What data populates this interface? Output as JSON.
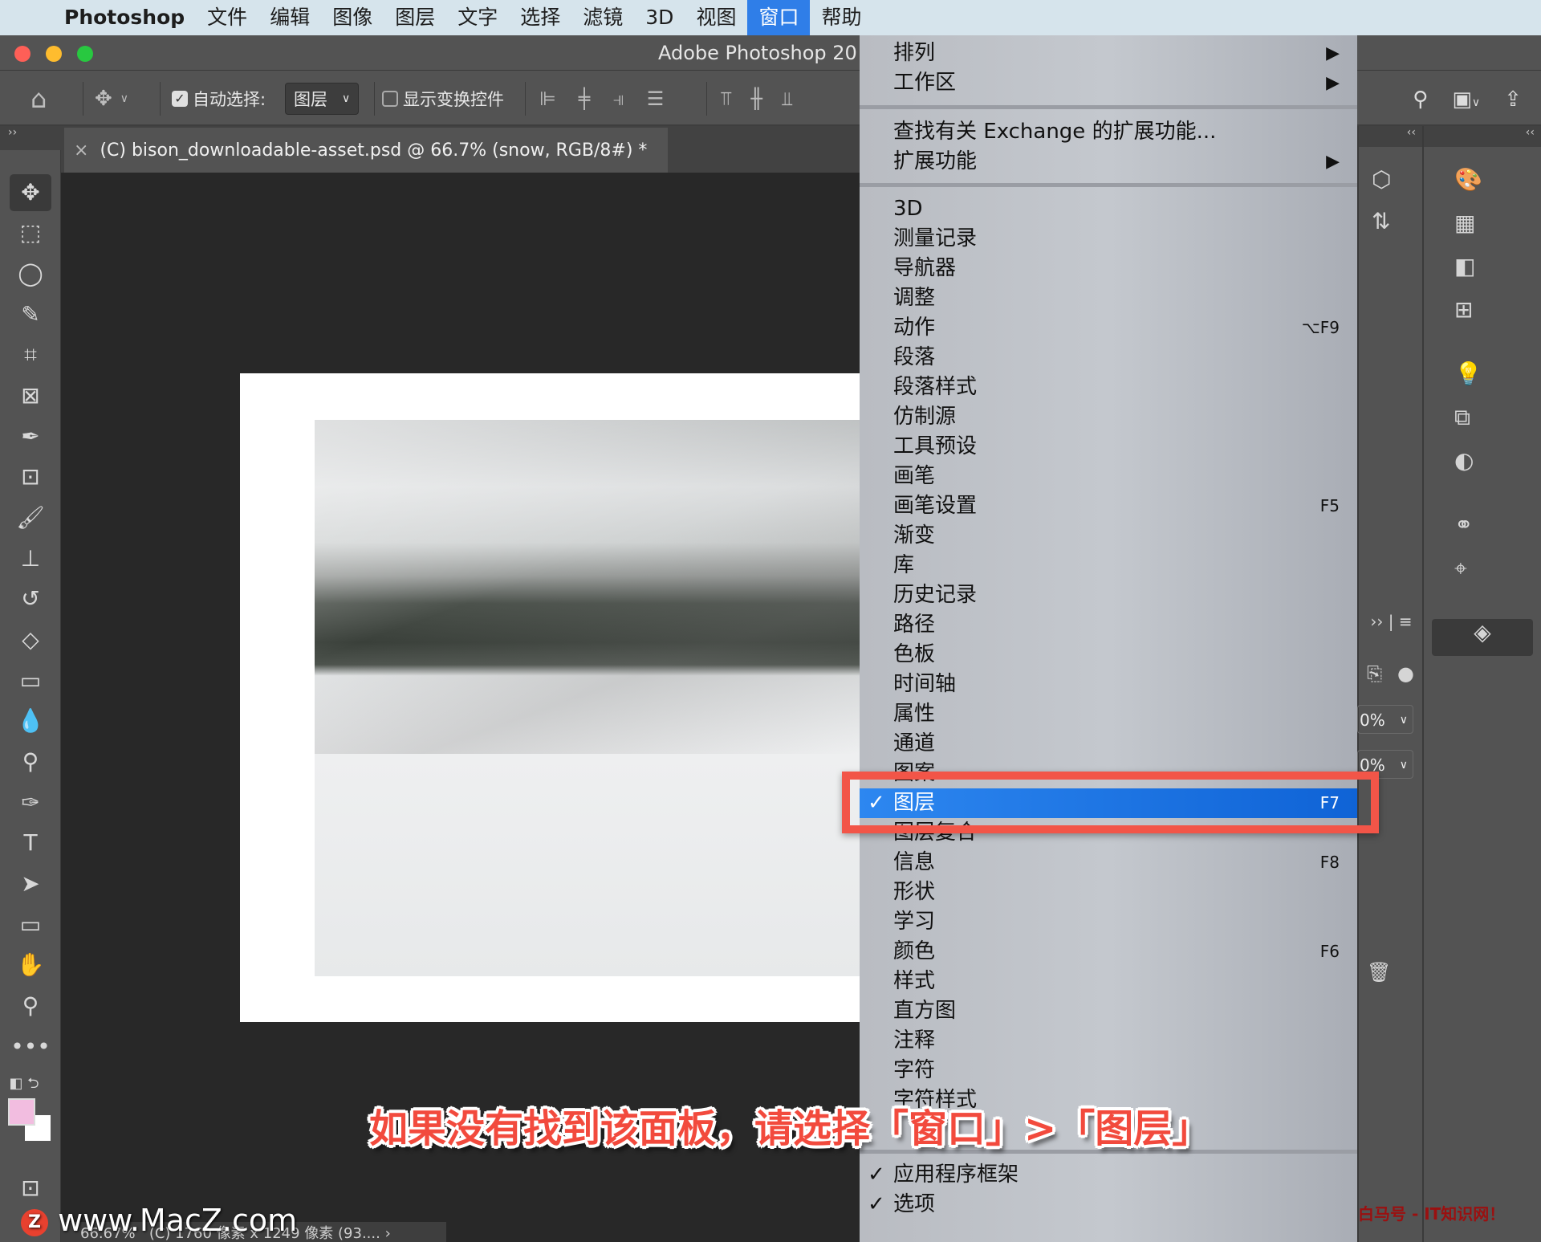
{
  "menubar": {
    "apple": "",
    "app": "Photoshop",
    "items": [
      "文件",
      "编辑",
      "图像",
      "图层",
      "文字",
      "选择",
      "滤镜",
      "3D",
      "视图",
      "窗口",
      "帮助"
    ],
    "active": "窗口"
  },
  "window": {
    "title": "Adobe Photoshop 20"
  },
  "options": {
    "auto_select_label": "自动选择:",
    "auto_select_checked": true,
    "auto_select_target": "图层",
    "show_transform_label": "显示变换控件",
    "show_transform_checked": false
  },
  "document_tab": {
    "close": "×",
    "title": "(C) bison_downloadable-asset.psd @ 66.7% (snow, RGB/8#) *"
  },
  "window_menu": {
    "group1": [
      {
        "label": "排列",
        "submenu": true
      },
      {
        "label": "工作区",
        "submenu": true
      }
    ],
    "group2": [
      {
        "label": "查找有关 Exchange 的扩展功能..."
      },
      {
        "label": "扩展功能",
        "submenu": true
      }
    ],
    "group3": [
      {
        "label": "3D"
      },
      {
        "label": "测量记录"
      },
      {
        "label": "导航器"
      },
      {
        "label": "调整"
      },
      {
        "label": "动作",
        "shortcut": "⌥F9"
      },
      {
        "label": "段落"
      },
      {
        "label": "段落样式"
      },
      {
        "label": "仿制源"
      },
      {
        "label": "工具预设"
      },
      {
        "label": "画笔"
      },
      {
        "label": "画笔设置",
        "shortcut": "F5"
      },
      {
        "label": "渐变"
      },
      {
        "label": "库"
      },
      {
        "label": "历史记录"
      },
      {
        "label": "路径"
      },
      {
        "label": "色板"
      },
      {
        "label": "时间轴"
      },
      {
        "label": "属性"
      },
      {
        "label": "通道"
      },
      {
        "label": "图案"
      },
      {
        "label": "图层",
        "shortcut": "F7",
        "checked": true,
        "highlighted": true
      },
      {
        "label": "图层复合"
      },
      {
        "label": "信息",
        "shortcut": "F8"
      },
      {
        "label": "形状"
      },
      {
        "label": "学习"
      },
      {
        "label": "颜色",
        "shortcut": "F6"
      },
      {
        "label": "样式"
      },
      {
        "label": "直方图"
      },
      {
        "label": "注释"
      },
      {
        "label": "字符"
      },
      {
        "label": "字符样式"
      }
    ],
    "group4": [
      {
        "label": "应用程序框架",
        "checked": true
      },
      {
        "label": "选项",
        "checked": true
      }
    ]
  },
  "caption": "如果没有找到该面板，请选择「窗口」>「图层」",
  "layers_panel": {
    "opacity": "0%",
    "fill": "0%"
  },
  "status": {
    "zoom": "66.67%",
    "info": "(C) 1760 像素 x 1249 像素 (93...."
  },
  "watermarks": {
    "left": "www.MacZ.com",
    "right": "白马号 - IT知识网！"
  },
  "colors": {
    "highlight": "#1a6fe0",
    "annotation": "#f25548",
    "foreground": "#f2bde0",
    "background": "#ffffff"
  }
}
